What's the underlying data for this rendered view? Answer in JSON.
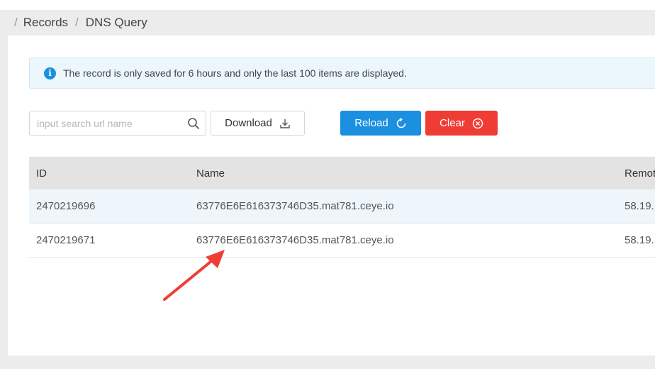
{
  "breadcrumb": {
    "sep": "/",
    "items": [
      "Records",
      "DNS Query"
    ]
  },
  "alert": {
    "icon": "info-icon",
    "text": "The record is only saved for 6 hours and only the last 100 items are displayed."
  },
  "search": {
    "placeholder": "input search url name",
    "value": ""
  },
  "buttons": {
    "download": "Download",
    "reload": "Reload",
    "clear": "Clear"
  },
  "colors": {
    "primary": "#1b8fe0",
    "danger": "#ef3d36",
    "arrow": "#ef3d36"
  },
  "table": {
    "columns": [
      "ID",
      "Name",
      "Remot"
    ],
    "rows": [
      {
        "id": "2470219696",
        "name": "63776E6E616373746D35.mat781.ceye.io",
        "remote": "58.19."
      },
      {
        "id": "2470219671",
        "name": "63776E6E616373746D35.mat781.ceye.io",
        "remote": "58.19."
      }
    ]
  }
}
